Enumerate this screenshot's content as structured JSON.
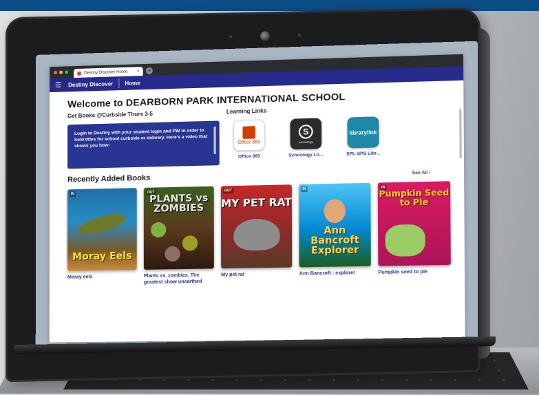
{
  "browser": {
    "tab_title": "Destiny Discover Home",
    "tab_close": "×",
    "new_tab": "+",
    "dot_colors": [
      "#ff5f57",
      "#febc2e",
      "#28c840"
    ]
  },
  "appbar": {
    "menu_icon": "☰",
    "app_name": "Destiny Discover",
    "page_name": "Home",
    "color": "#262a8c"
  },
  "page": {
    "title": "Welcome to DEARBORN PARK INTERNATIONAL SCHOOL",
    "curbside_heading": "Get Books @Curbside Thurs 3-5",
    "notice_text": "Login to Destiny with your student login and PW in order to hold titles for school curbside or delivery. Here's a video that shows you how:",
    "learning_links_heading": "Learning Links",
    "learning_links": [
      {
        "label": "Office 365",
        "icon": "office-365-icon",
        "tile_text": "Office 365"
      },
      {
        "label": "Schoology Lo...",
        "icon": "schoology-icon",
        "tile_text": "S",
        "tile_sub": "schoology"
      },
      {
        "label": "SPL-SPS Libr...",
        "icon": "library-link-icon",
        "tile_text": "librarylink"
      }
    ],
    "recent_heading": "Recently Added Books",
    "see_all": "See All ›"
  },
  "books": [
    {
      "title": "Moray eels",
      "badge": "IN",
      "cover_text": "Moray Eels"
    },
    {
      "title": "Plants vs. zombies. The greatest show unearthed",
      "badge": "OUT",
      "cover_text": "PLANTS vs ZOMBIES"
    },
    {
      "title": "My pet rat",
      "badge": "OUT",
      "cover_text": "MY PET RAT"
    },
    {
      "title": "Ann Bancroft : explorer",
      "badge": "IN",
      "cover_text": "Ann Bancroft Explorer"
    },
    {
      "title": "Pumpkin seed to pie",
      "badge": "IN",
      "cover_text": "Pumpkin Seed to Pie"
    }
  ]
}
